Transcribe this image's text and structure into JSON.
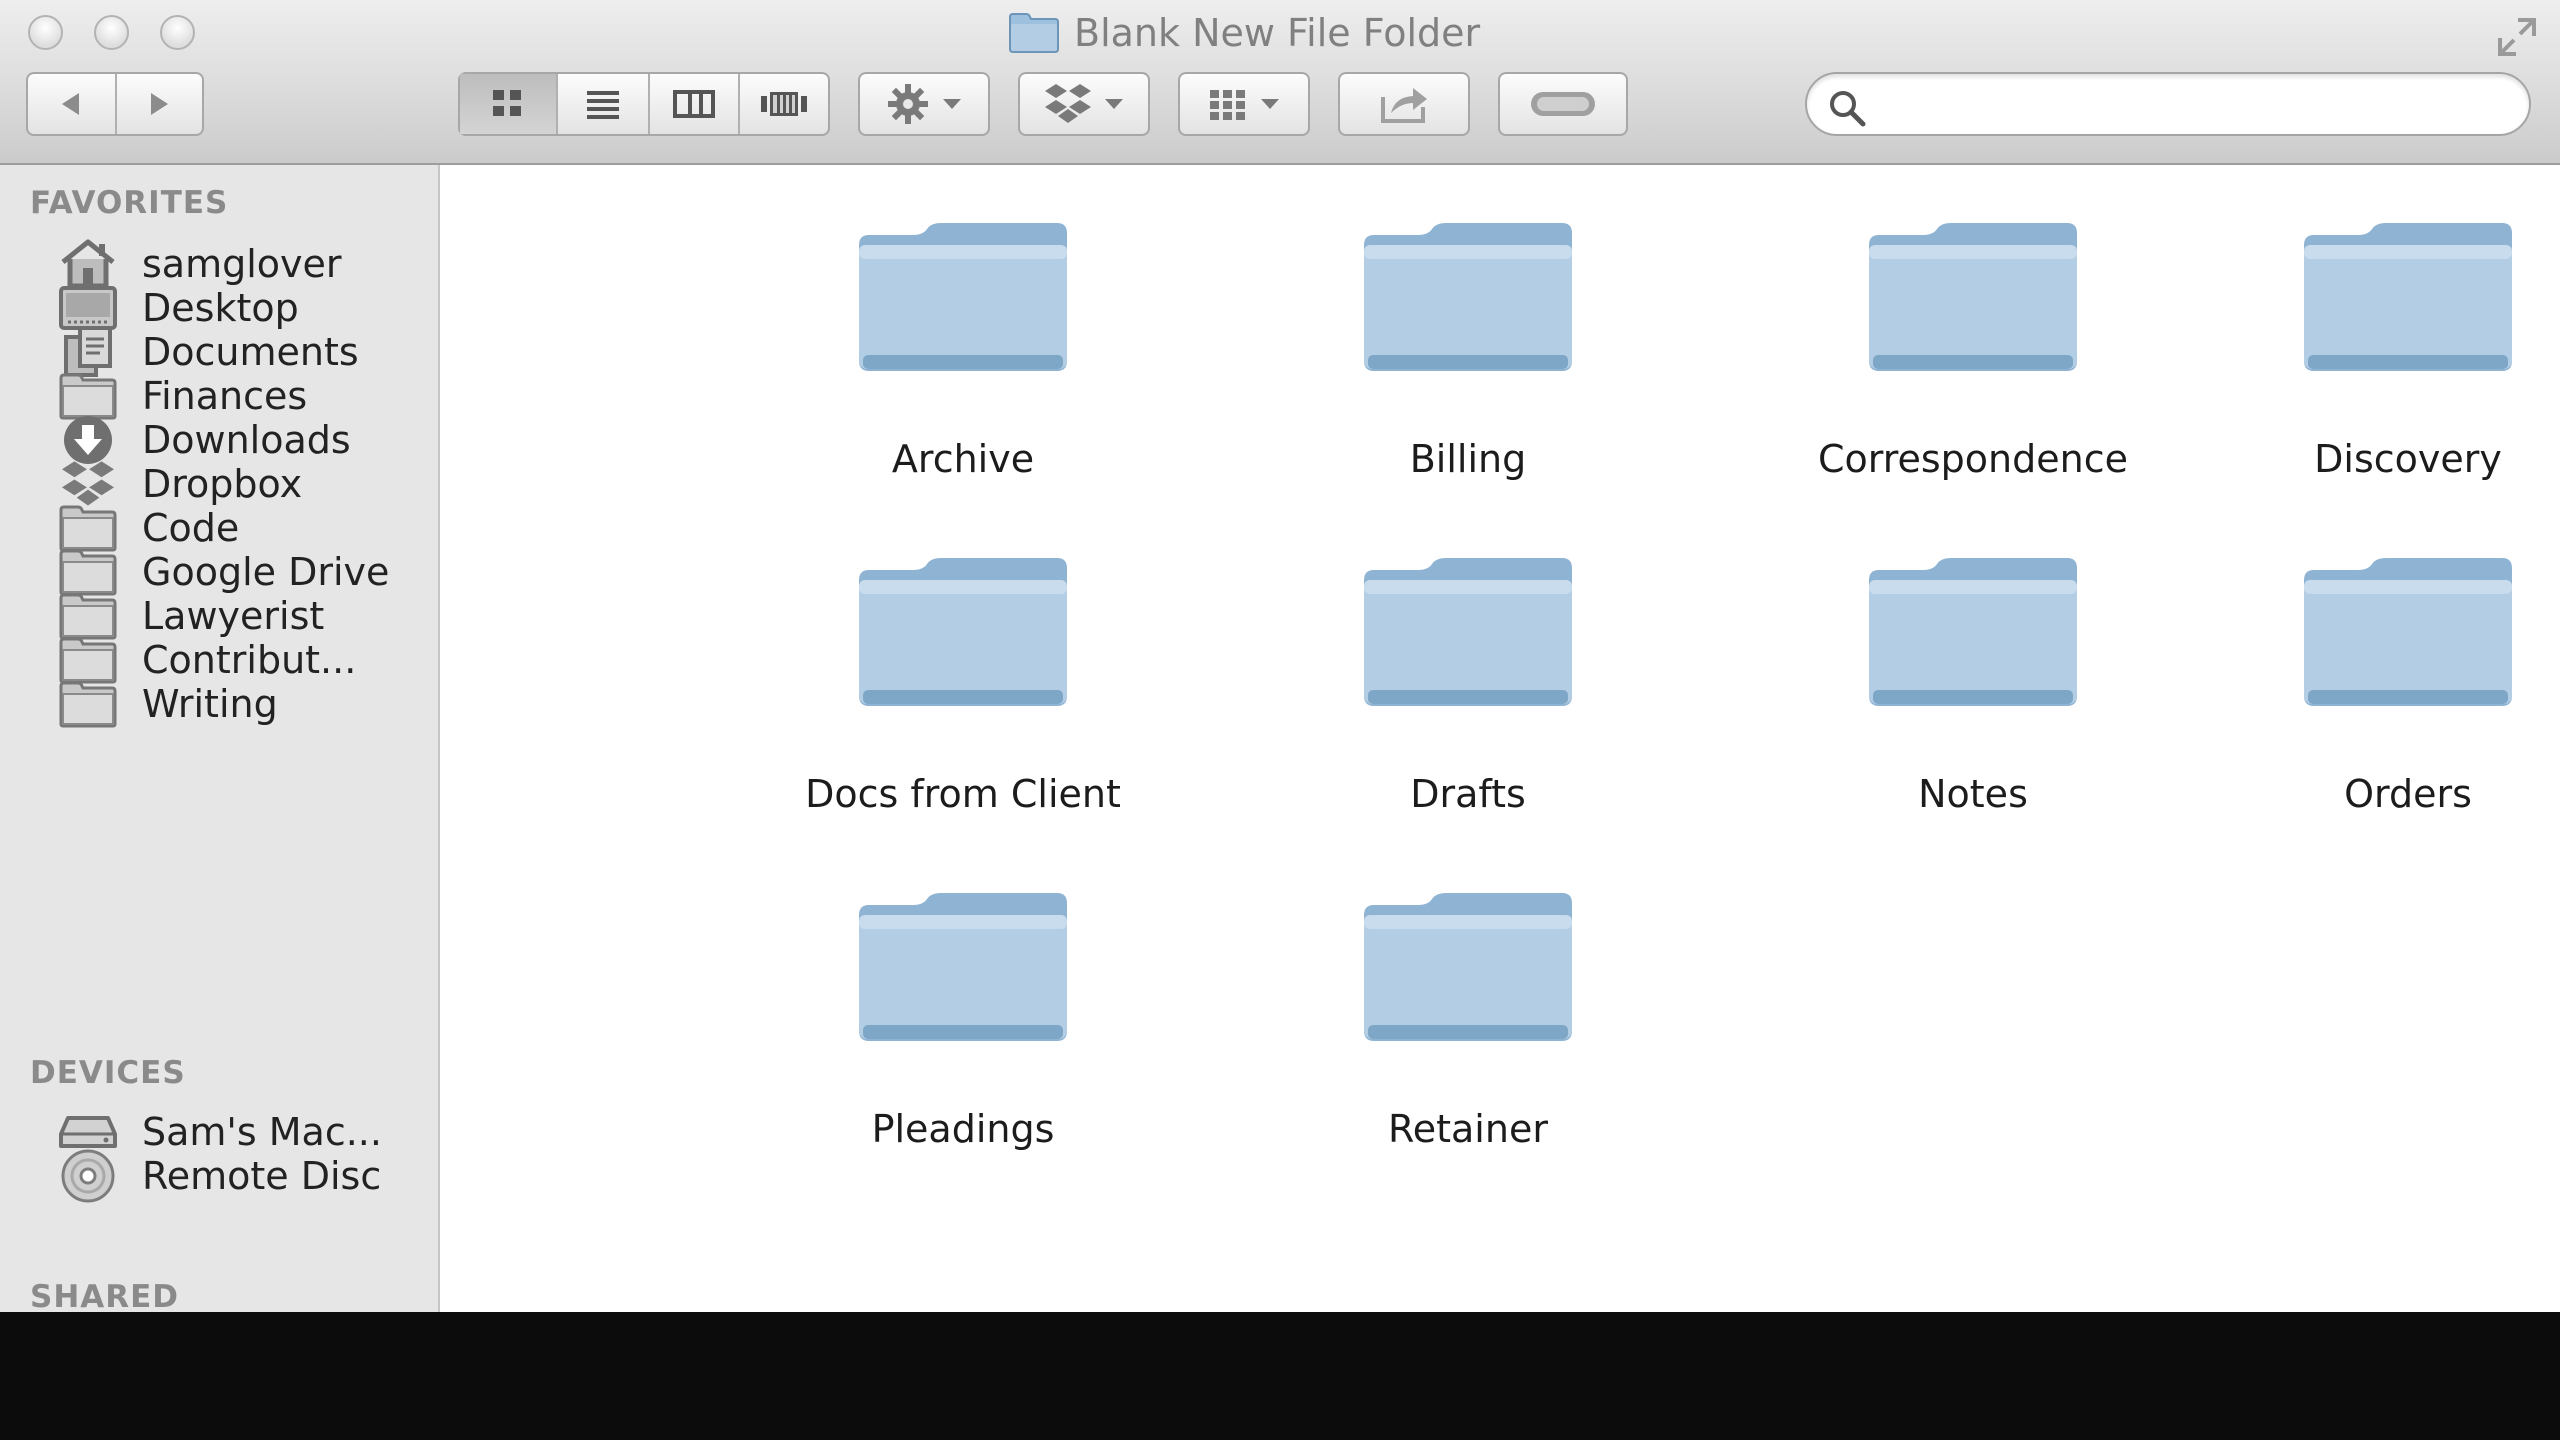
{
  "window": {
    "title": "Blank New File Folder",
    "title_icon": "folder-icon"
  },
  "toolbar": {
    "back_icon": "back-arrow-icon",
    "forward_icon": "forward-arrow-icon",
    "view_modes": [
      "icon-view",
      "list-view",
      "column-view",
      "cover-flow-view"
    ],
    "active_view": "icon-view",
    "action_menu_icon": "gear-icon",
    "dropbox_menu_icon": "dropbox-icon",
    "arrange_menu_icon": "arrange-grid-icon",
    "share_icon": "share-icon",
    "tags_icon": "tag-toggle-icon",
    "search": {
      "value": "",
      "placeholder": ""
    }
  },
  "sidebar": {
    "favorites_label": "FAVORITES",
    "favorites": [
      {
        "label": "samglover",
        "icon": "home-icon"
      },
      {
        "label": "Desktop",
        "icon": "desktop-icon"
      },
      {
        "label": "Documents",
        "icon": "documents-icon"
      },
      {
        "label": "Finances",
        "icon": "folder-icon"
      },
      {
        "label": "Downloads",
        "icon": "downloads-icon"
      },
      {
        "label": "Dropbox",
        "icon": "dropbox-icon"
      },
      {
        "label": "Code",
        "icon": "folder-icon"
      },
      {
        "label": "Google Drive",
        "icon": "folder-icon"
      },
      {
        "label": "Lawyerist",
        "icon": "folder-icon"
      },
      {
        "label": "Contribut...",
        "icon": "folder-icon"
      },
      {
        "label": "Writing",
        "icon": "folder-icon"
      }
    ],
    "devices_label": "DEVICES",
    "devices": [
      {
        "label": "Sam's Mac...",
        "icon": "hard-drive-icon"
      },
      {
        "label": "Remote Disc",
        "icon": "disc-icon"
      }
    ],
    "shared_label": "SHARED"
  },
  "folders": [
    {
      "label": "Archive"
    },
    {
      "label": "Billing"
    },
    {
      "label": "Correspondence"
    },
    {
      "label": "Discovery"
    },
    {
      "label": "Docs from Client"
    },
    {
      "label": "Drafts"
    },
    {
      "label": "Notes"
    },
    {
      "label": "Orders"
    },
    {
      "label": "Pleadings"
    },
    {
      "label": "Retainer"
    }
  ],
  "colors": {
    "folder_blue": "#8fb4d3",
    "folder_light": "#b9d2e6",
    "sidebar_bg": "#e6e6e6",
    "desktop_bg": "#0c0c0c"
  }
}
